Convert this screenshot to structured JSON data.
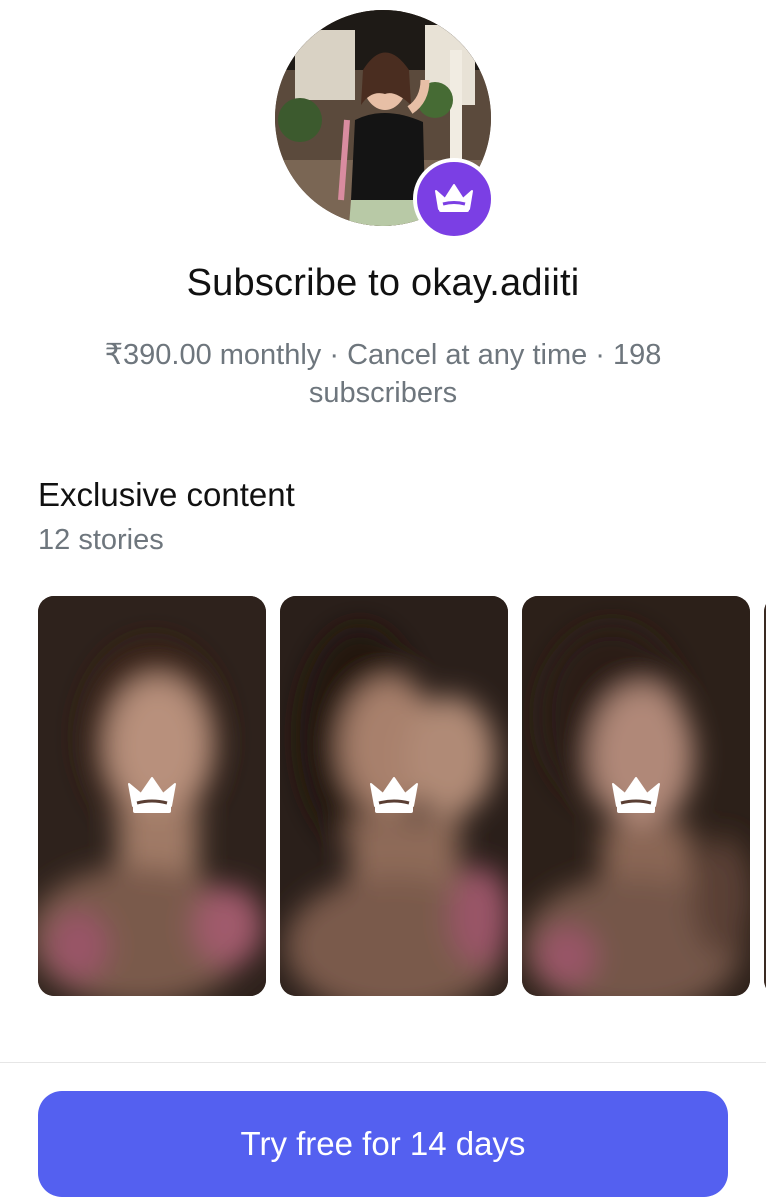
{
  "header": {
    "title": "Subscribe to okay.adiiti",
    "subtitle": "₹390.00 monthly · Cancel at any time · 198 subscribers"
  },
  "avatar": {
    "badge_icon": "crown-icon",
    "badge_color": "#7b3fe4"
  },
  "exclusive": {
    "title": "Exclusive content",
    "count_label": "12 stories",
    "stories": [
      {
        "lock_icon": "crown-icon"
      },
      {
        "lock_icon": "crown-icon"
      },
      {
        "lock_icon": "crown-icon"
      }
    ]
  },
  "cta": {
    "label": "Try free for 14 days",
    "color": "#5460f0"
  }
}
